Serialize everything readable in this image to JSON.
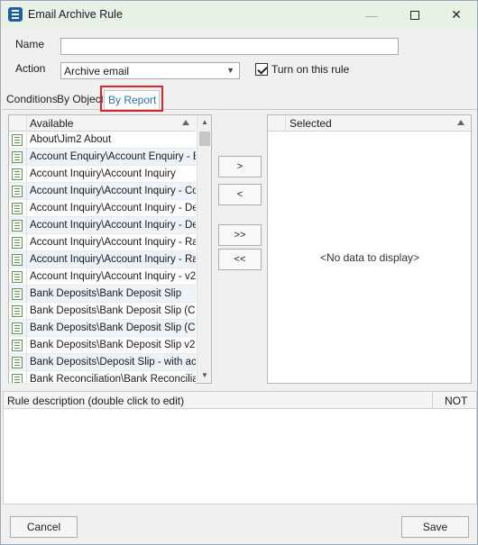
{
  "window": {
    "title": "Email Archive Rule",
    "controls": {
      "minimize_icon": "minimize-icon",
      "maximize_icon": "maximize-icon",
      "close_icon": "close-icon"
    }
  },
  "form": {
    "name_label": "Name",
    "name_value": "",
    "action_label": "Action",
    "action_value": "Archive email",
    "turn_on_label": "Turn on this rule",
    "turn_on_checked": true
  },
  "tabs": [
    {
      "label": "Conditions",
      "active": false
    },
    {
      "label": "By Object",
      "active": false
    },
    {
      "label": "By Report",
      "active": true
    }
  ],
  "available": {
    "column_header": "Available",
    "items": [
      "About\\Jim2 About",
      "Account Enquiry\\Account Enquiry - Exp",
      "Account Inquiry\\Account Inquiry",
      "Account Inquiry\\Account Inquiry - Cop",
      "Account Inquiry\\Account Inquiry - Det",
      "Account Inquiry\\Account Inquiry - Det",
      "Account Inquiry\\Account Inquiry - Rar",
      "Account Inquiry\\Account Inquiry - Rar",
      "Account Inquiry\\Account Inquiry - v2",
      "Bank Deposits\\Bank Deposit Slip",
      "Bank Deposits\\Bank Deposit Slip (Cash",
      "Bank Deposits\\Bank Deposit Slip (Cash",
      "Bank Deposits\\Bank Deposit Slip v2",
      "Bank Deposits\\Deposit Slip - with acc ir",
      "Bank Reconciliation\\Bank Reconciliatior"
    ]
  },
  "move_buttons": {
    "add": ">",
    "remove": "<",
    "add_all": ">>",
    "remove_all": "<<"
  },
  "selected": {
    "column_header": "Selected",
    "empty_text": "<No data to display>"
  },
  "rule_description": {
    "header": "Rule description (double click to edit)",
    "not_label": "NOT"
  },
  "footer": {
    "cancel_label": "Cancel",
    "save_label": "Save"
  },
  "colors": {
    "title_bar": "#e9f1e6",
    "active_tab_text": "#2b6fb6",
    "highlight_border": "#d9262c"
  }
}
